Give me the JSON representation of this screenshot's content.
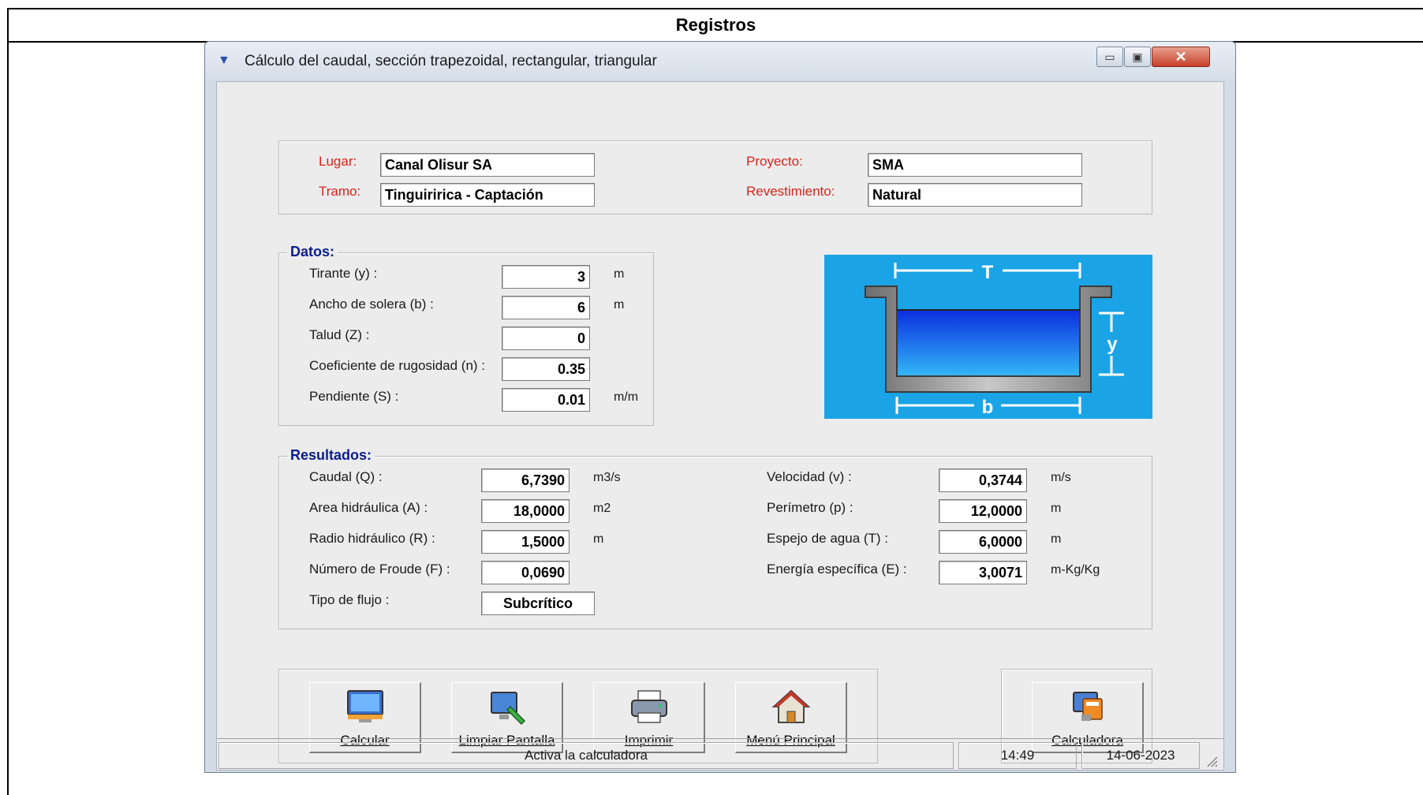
{
  "document": {
    "header": "Registros"
  },
  "window": {
    "title": "Cálculo del caudal, sección trapezoidal, rectangular, triangular",
    "controls": {
      "minimize": "▭",
      "maximize": "▣",
      "close": "✕"
    }
  },
  "info": {
    "lugar_label": "Lugar:",
    "lugar_value": "Canal Olisur SA",
    "tramo_label": "Tramo:",
    "tramo_value": "Tinguiririca - Captación",
    "proyecto_label": "Proyecto:",
    "proyecto_value": "SMA",
    "revestimiento_label": "Revestimiento:",
    "revestimiento_value": "Natural"
  },
  "datos": {
    "legend": "Datos:",
    "fields": [
      {
        "label": "Tirante (y) :",
        "value": "3",
        "unit": "m"
      },
      {
        "label": "Ancho de solera (b) :",
        "value": "6",
        "unit": "m"
      },
      {
        "label": "Talud  (Z) :",
        "value": "0",
        "unit": ""
      },
      {
        "label": "Coeficiente de rugosidad (n) :",
        "value": "0.35",
        "unit": ""
      },
      {
        "label": "Pendiente (S) :",
        "value": "0.01",
        "unit": "m/m"
      }
    ]
  },
  "diagram": {
    "top_label": "T",
    "side_label": "y",
    "bottom_label": "b"
  },
  "resultados": {
    "legend": "Resultados:",
    "left": [
      {
        "label": "Caudal (Q) :",
        "value": "6,7390",
        "unit": "m3/s"
      },
      {
        "label": "Area hidráulica (A) :",
        "value": "18,0000",
        "unit": "m2"
      },
      {
        "label": "Radio hidráulico (R) :",
        "value": "1,5000",
        "unit": "m"
      },
      {
        "label": "Número de Froude (F) :",
        "value": "0,0690",
        "unit": ""
      },
      {
        "label": "Tipo de flujo :",
        "value": "Subcrítico",
        "unit": ""
      }
    ],
    "right": [
      {
        "label": "Velocidad (v) :",
        "value": "0,3744",
        "unit": "m/s"
      },
      {
        "label": "Perímetro (p) :",
        "value": "12,0000",
        "unit": "m"
      },
      {
        "label": "Espejo de agua (T) :",
        "value": "6,0000",
        "unit": "m"
      },
      {
        "label": "Energía específica (E) :",
        "value": "3,0071",
        "unit": "m-Kg/Kg"
      }
    ]
  },
  "toolbar": {
    "calcular": "Calcular",
    "limpiar": "Limpiar Pantalla",
    "imprimir": "Imprimir",
    "menu": "Menú Principal",
    "calculadora": "Calculadora"
  },
  "statusbar": {
    "message": "Activa la calculadora",
    "time": "14:49",
    "date": "14-06-2023"
  }
}
